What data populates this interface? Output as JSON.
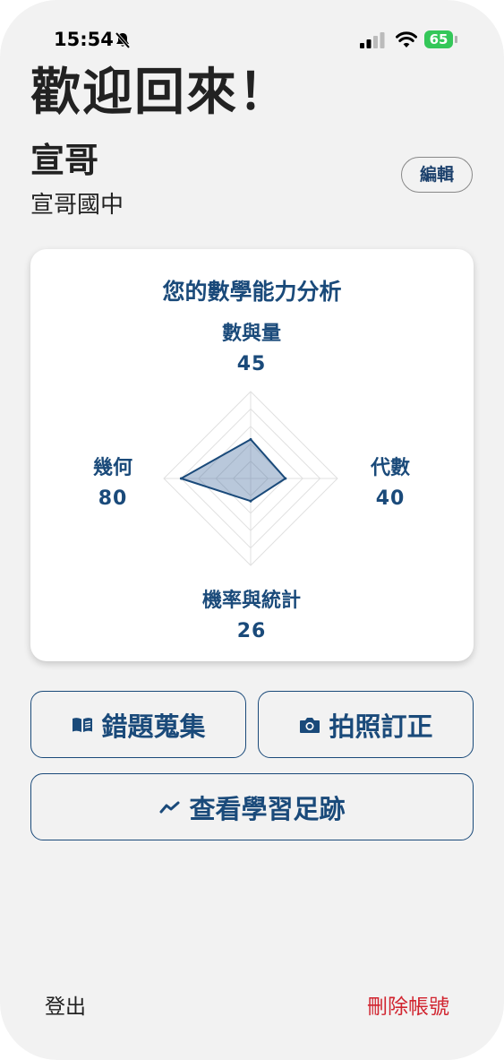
{
  "status_bar": {
    "time": "15:54",
    "battery": "65"
  },
  "header": {
    "welcome": "歡迎回來！"
  },
  "profile": {
    "name": "宣哥",
    "school": "宣哥國中",
    "edit_label": "編輯"
  },
  "analysis": {
    "title": "您的數學能力分析",
    "accent_color": "#1a4a7a",
    "chart_data": {
      "type": "radar",
      "title": "您的數學能力分析",
      "axes": [
        "數與量",
        "代數",
        "機率與統計",
        "幾何"
      ],
      "series": [
        {
          "values": [
            45,
            40,
            26,
            80
          ]
        }
      ],
      "range": [
        0,
        100
      ],
      "grid_levels": 5
    },
    "labels": {
      "top": {
        "name": "數與量",
        "value": "45"
      },
      "right": {
        "name": "代數",
        "value": "40"
      },
      "bottom": {
        "name": "機率與統計",
        "value": "26"
      },
      "left": {
        "name": "幾何",
        "value": "80"
      }
    }
  },
  "actions": {
    "mistakes": {
      "label": "錯題蒐集",
      "icon": "book-icon"
    },
    "photo": {
      "label": "拍照訂正",
      "icon": "camera-icon"
    },
    "footprint": {
      "label": "查看學習足跡",
      "icon": "trend-icon"
    }
  },
  "footer": {
    "logout": "登出",
    "delete_account": "刪除帳號",
    "delete_color": "#d1242f"
  }
}
